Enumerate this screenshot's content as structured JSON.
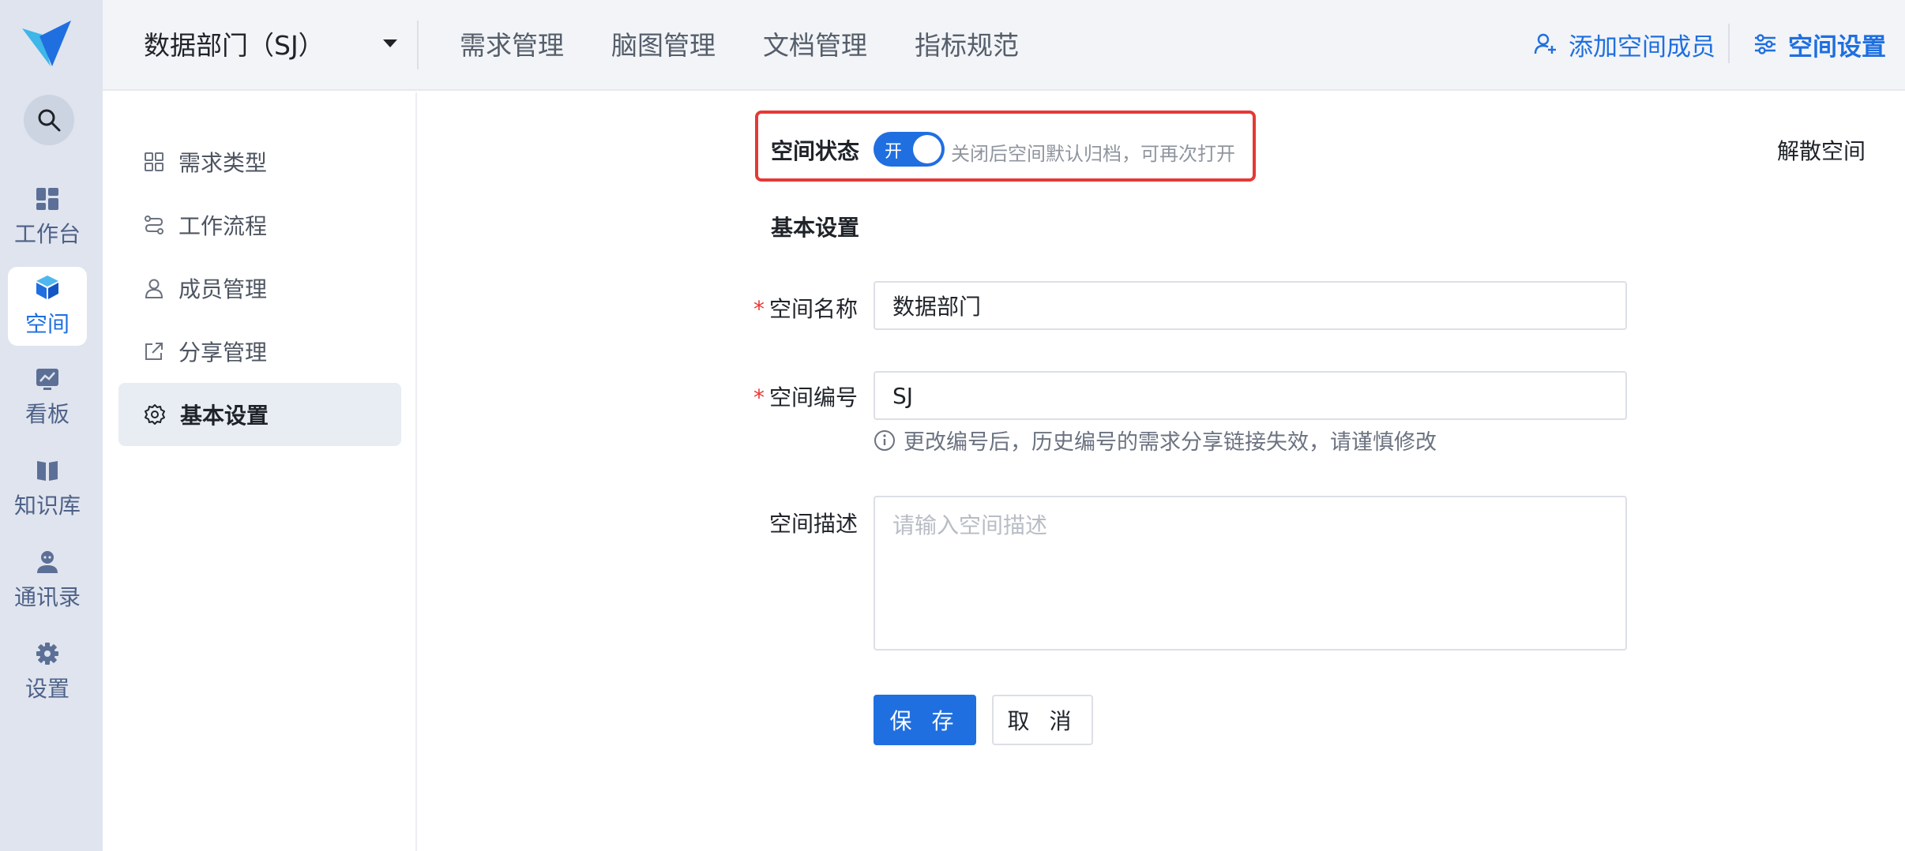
{
  "rail": {
    "items": [
      {
        "label": "工作台",
        "icon": "dashboard-icon"
      },
      {
        "label": "空间",
        "icon": "cube-icon"
      },
      {
        "label": "看板",
        "icon": "chart-board-icon"
      },
      {
        "label": "知识库",
        "icon": "book-icon"
      },
      {
        "label": "通讯录",
        "icon": "contacts-icon"
      },
      {
        "label": "设置",
        "icon": "gear-icon"
      }
    ],
    "active": "空间"
  },
  "header": {
    "space_name": "数据部门（SJ）",
    "tabs": [
      "需求管理",
      "脑图管理",
      "文档管理",
      "指标规范"
    ],
    "add_member": "添加空间成员",
    "space_settings": "空间设置"
  },
  "subnav": {
    "items": [
      {
        "label": "需求类型",
        "icon": "grid-icon"
      },
      {
        "label": "工作流程",
        "icon": "workflow-icon"
      },
      {
        "label": "成员管理",
        "icon": "user-icon"
      },
      {
        "label": "分享管理",
        "icon": "share-icon"
      },
      {
        "label": "基本设置",
        "icon": "gear-icon"
      }
    ],
    "active": "基本设置"
  },
  "content": {
    "status_label": "空间状态",
    "toggle_text": "开",
    "status_hint": "关闭后空间默认归档，可再次打开",
    "disband": "解散空间",
    "section_title": "基本设置",
    "name_label": "空间名称",
    "name_value": "数据部门",
    "code_label": "空间编号",
    "code_value": "SJ",
    "code_hint": "更改编号后，历史编号的需求分享链接失效，请谨慎修改",
    "desc_label": "空间描述",
    "desc_placeholder": "请输入空间描述",
    "save": "保 存",
    "cancel": "取 消",
    "required_mark": "*"
  },
  "colors": {
    "accent": "#1f6fe0",
    "highlight_frame": "#e53935"
  }
}
